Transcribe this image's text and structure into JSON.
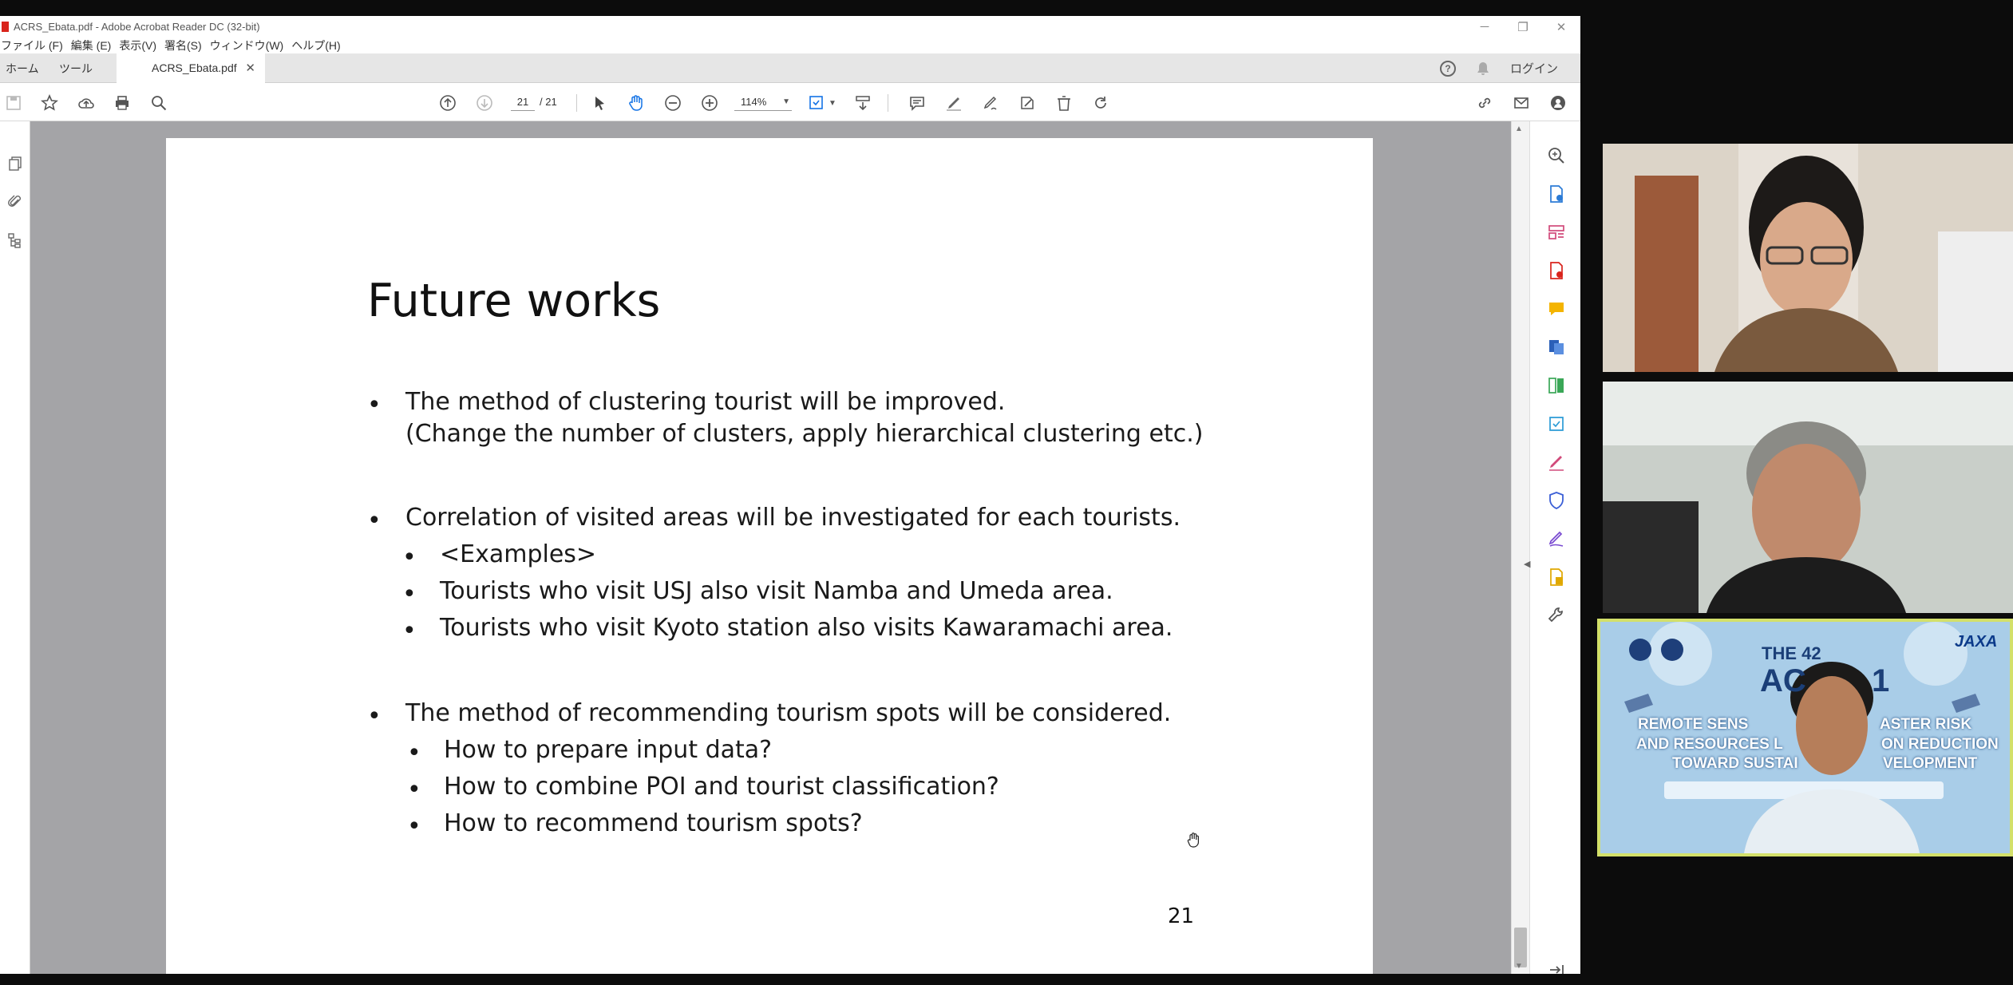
{
  "window": {
    "title": "ACRS_Ebata.pdf - Adobe Acrobat Reader DC (32-bit)",
    "minimize": "─",
    "restore": "❐",
    "close": "✕"
  },
  "menu": [
    "ファイル (F)",
    "編集 (E)",
    "表示(V)",
    "署名(S)",
    "ウィンドウ(W)",
    "ヘルプ(H)"
  ],
  "tabs": {
    "home": "ホーム",
    "tools": "ツール",
    "document": "ACRS_Ebata.pdf",
    "close": "✕",
    "login": "ログイン",
    "help_glyph": "?"
  },
  "toolbar": {
    "current_page": "21",
    "total_pages": "/ 21",
    "zoom": "114%"
  },
  "slide": {
    "title": "Future works",
    "bullet": "•",
    "lines": [
      "The method of clustering tourist will be improved.",
      "(Change the number of clusters, apply hierarchical clustering etc.)",
      "Correlation of visited areas will be investigated for each tourists.",
      "<Examples>",
      "Tourists who visit USJ also visit Namba and Umeda area.",
      "Tourists who visit Kyoto station also visits Kawaramachi area.",
      "The method of recommending tourism spots will be considered.",
      "How to prepare input data?",
      "How to combine POI and tourist classification?",
      "How to recommend tourism spots?"
    ],
    "page_number": "21"
  },
  "video3_background": {
    "conf_prefix": "THE 42",
    "conf_name": "AC",
    "conf_suffix": "1",
    "line1": "REMOTE SENS",
    "line1b": "ASTER RISK",
    "line2": "AND RESOURCES L",
    "line2b": "ON REDUCTION",
    "line3": "TOWARD SUSTAI",
    "line3b": "VELOPMENT",
    "sponsor": "JAXA"
  },
  "colors": {
    "acrobat_red": "#d9241c",
    "viewer_gray": "#a4a4a7",
    "active_tool_blue": "#1473e6",
    "video_highlight": "#d3e06a"
  }
}
